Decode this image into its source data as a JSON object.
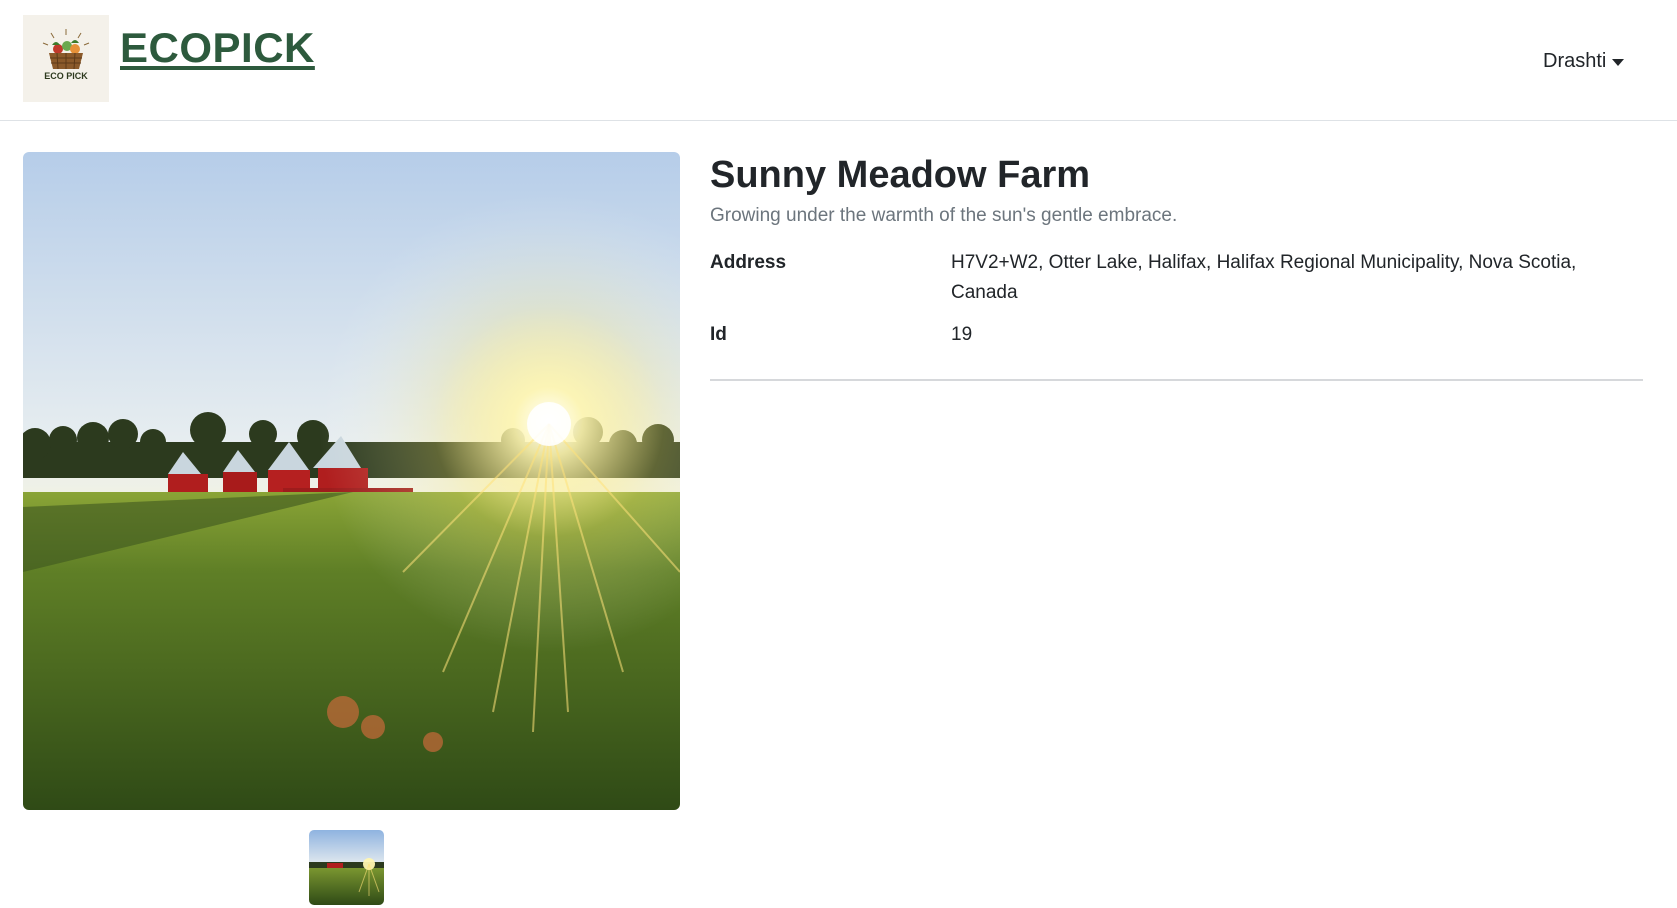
{
  "header": {
    "brand": "ECOPICK",
    "logo_text": "ECO PICK",
    "user_name": "Drashti"
  },
  "farm": {
    "name": "Sunny Meadow Farm",
    "tagline": "Growing under the warmth of the sun's gentle embrace.",
    "details": [
      {
        "label": "Address",
        "value": "H7V2+W2, Otter Lake, Halifax, Halifax Regional Municipality, Nova Scotia, Canada"
      },
      {
        "label": "Id",
        "value": "19"
      }
    ]
  },
  "colors": {
    "brand": "#2d5a3d",
    "text": "#212529",
    "muted": "#6c757d"
  }
}
